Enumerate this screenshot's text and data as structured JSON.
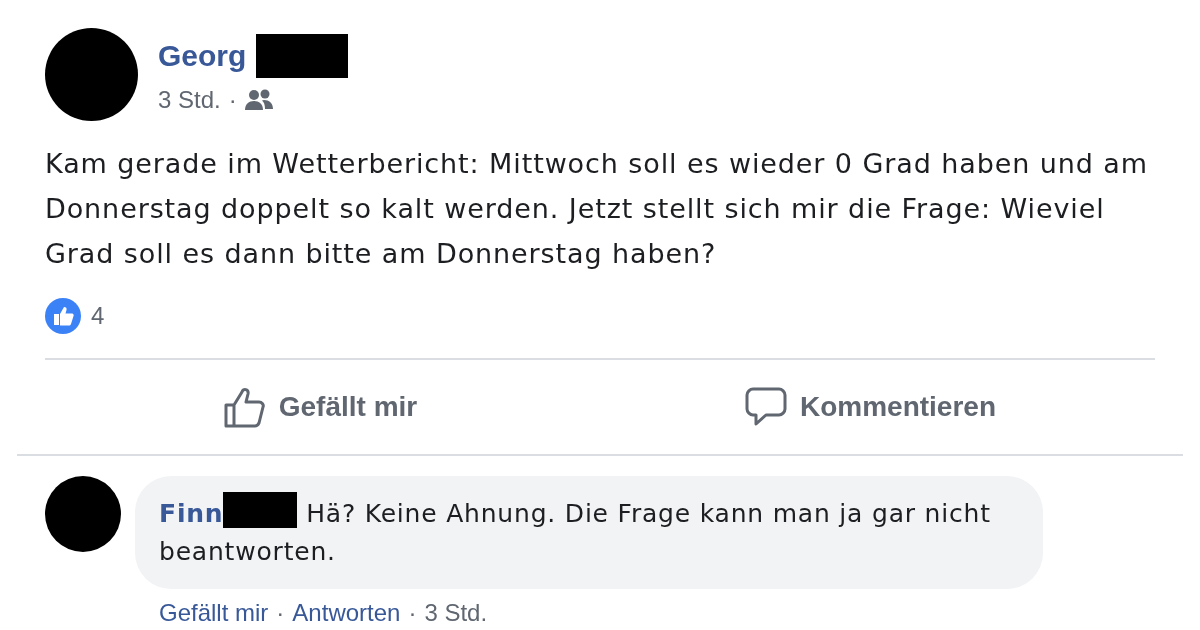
{
  "post": {
    "author": "Georg",
    "author_redacted": true,
    "time": "3 Std.",
    "separator": "·",
    "text": "Kam gerade im Wetterbericht: Mittwoch soll es wieder 0 Grad haben und am Donnerstag doppelt so kalt werden. Jetzt stellt sich mir die Frage: Wieviel Grad soll es dann bitte am Donnerstag haben?",
    "likes": "4"
  },
  "actions": [
    {
      "kind": "like",
      "label": "Gefällt mir"
    },
    {
      "kind": "comment",
      "label": "Kommentieren"
    }
  ],
  "comment": {
    "author": "Finn",
    "author_redacted": true,
    "text": "Hä? Keine Ahnung. Die Frage kann man ja gar nicht beantworten.",
    "separator": "·",
    "actions": [
      {
        "kind": "link",
        "label": "Gefällt mir"
      },
      {
        "kind": "link",
        "label": "Antworten"
      },
      {
        "kind": "time",
        "label": "3 Std."
      }
    ]
  }
}
